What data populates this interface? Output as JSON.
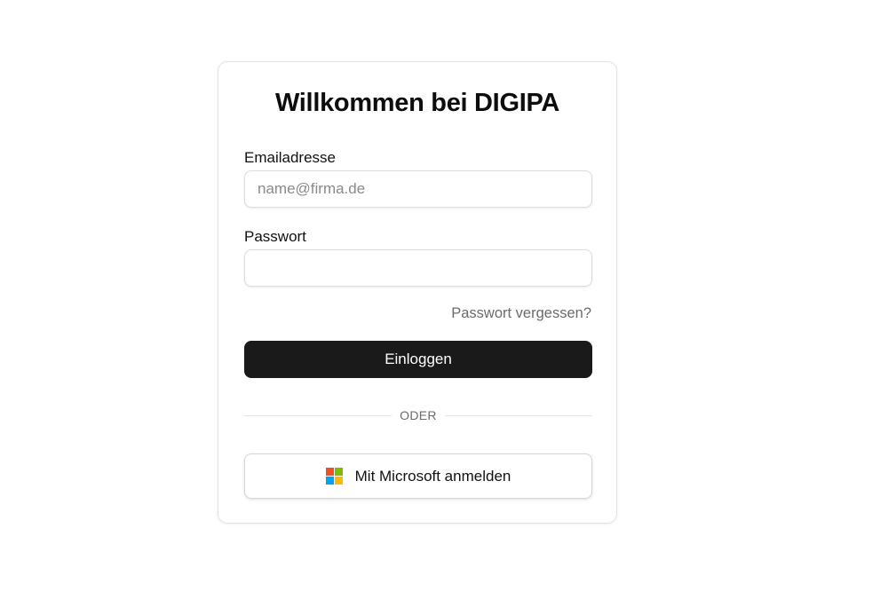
{
  "login": {
    "title": "Willkommen bei DIGIPA",
    "email_label": "Emailadresse",
    "email_placeholder": "name@firma.de",
    "email_value": "",
    "password_label": "Passwort",
    "password_value": "",
    "forgot_link": "Passwort vergessen?",
    "login_button": "Einloggen",
    "divider_text": "ODER",
    "microsoft_button": "Mit Microsoft anmelden",
    "microsoft_icon": "microsoft-logo-icon",
    "microsoft_colors": [
      "#f25022",
      "#7fba00",
      "#00a4ef",
      "#ffb900"
    ],
    "primary_button_color": "#1a1a1a"
  }
}
